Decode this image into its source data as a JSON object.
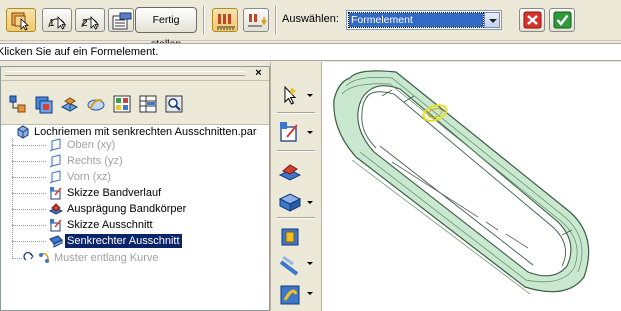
{
  "toolbar": {
    "finish_label": "Fertig stellen",
    "select_label": "Auswählen:",
    "select_value": "Formelement",
    "step1_label": "1",
    "step2_label": "2"
  },
  "prompt": "Klicken Sie auf ein Formelement.",
  "pathfinder": {
    "close_glyph": "×",
    "tree": {
      "root": "Lochriemen mit senkrechten Ausschnitten.par",
      "items": [
        {
          "label": "Oben (xy)",
          "state": "dim"
        },
        {
          "label": "Rechts (yz)",
          "state": "dim"
        },
        {
          "label": "Vorn (xz)",
          "state": "dim"
        },
        {
          "label": "Skizze Bandverlauf",
          "state": "normal"
        },
        {
          "label": "Ausprägung Bandkörper",
          "state": "normal"
        },
        {
          "label": "Skizze Ausschnitt",
          "state": "normal"
        },
        {
          "label": "Senkrechter Ausschnitt",
          "state": "selected"
        },
        {
          "label": "Muster entlang Kurve",
          "state": "dim"
        }
      ]
    }
  },
  "colors": {
    "selection": "#0a246a",
    "model_fill": "#c9e8cf",
    "model_edge": "#3b5e44",
    "cancel": "#d8322c",
    "accept": "#2e9a3a"
  },
  "icons": {
    "toolbar": [
      "select-part-icon",
      "step1-icon",
      "step2-icon",
      "feature-properties-icon",
      "rectangular-pattern-icon",
      "smart-dimension-icon",
      "cancel-icon",
      "accept-icon"
    ],
    "tabs": [
      "feature-tree-icon",
      "layers-icon",
      "assembly-icon",
      "sketch-icon",
      "library-icon",
      "table-icon",
      "zoom-icon"
    ],
    "vertical": [
      "select-arrow-icon",
      "sketch-plane-icon",
      "protrusion-icon",
      "cutout-icon",
      "thin-wall-icon",
      "pattern-icon",
      "hole-icon"
    ]
  }
}
